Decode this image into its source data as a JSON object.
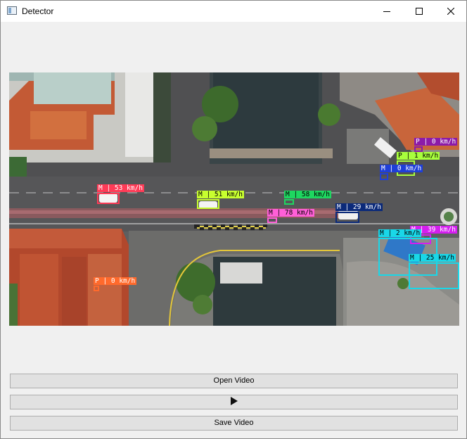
{
  "window": {
    "title": "Detector",
    "icon": "app-window-icon",
    "controls": [
      "minimize-icon",
      "maximize-icon",
      "close-icon"
    ]
  },
  "buttons": {
    "open": "Open Video",
    "play_icon": "play-icon",
    "save": "Save Video"
  },
  "detections": [
    {
      "label": "M | 53 km/h",
      "color": "#ff3b57"
    },
    {
      "label": "M | 51 km/h",
      "color": "#c8ff2f"
    },
    {
      "label": "M | 58 km/h",
      "color": "#1ed760"
    },
    {
      "label": "M | 78 km/h",
      "color": "#ff5fd7"
    },
    {
      "label": "M | 29 km/h",
      "color": "#0b2a7a"
    },
    {
      "label": "P | 0 km/h",
      "color": "#8c1aa8"
    },
    {
      "label": "P | 1 km/h",
      "color": "#a8ff3c"
    },
    {
      "label": "M | 0 km/h",
      "color": "#1f3fd8"
    },
    {
      "label": "M | 39 km/h",
      "color": "#d51ef0"
    },
    {
      "label": "M | 2 km/h",
      "color": "#19d7e8"
    },
    {
      "label": "M | 25 km/h",
      "color": "#19d7e8"
    },
    {
      "label": "P | 0 km/h",
      "color": "#ff6a2c"
    }
  ]
}
